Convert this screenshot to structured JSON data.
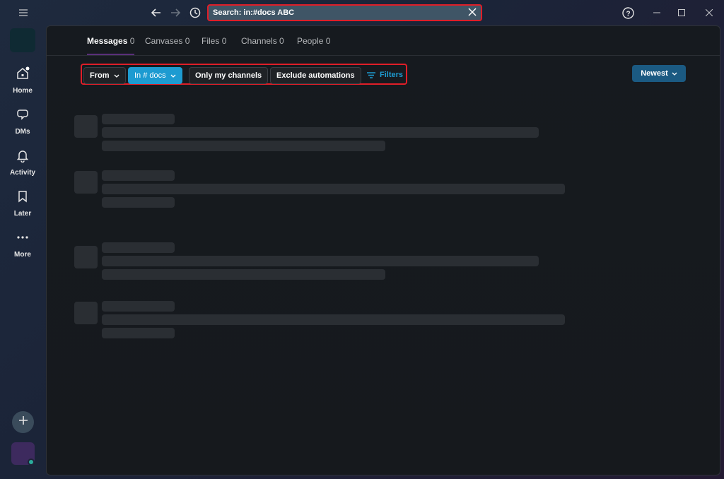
{
  "titlebar": {
    "search_text": "Search: in:#docs ABC",
    "icons": [
      "menu-icon",
      "back-arrow-icon",
      "forward-arrow-icon",
      "history-icon",
      "close-icon",
      "help-icon",
      "minimize-icon",
      "maximize-icon",
      "window-close-icon"
    ]
  },
  "rail": {
    "items": [
      {
        "label": "Home",
        "icon": "home-icon"
      },
      {
        "label": "DMs",
        "icon": "dms-icon"
      },
      {
        "label": "Activity",
        "icon": "bell-icon"
      },
      {
        "label": "Later",
        "icon": "bookmark-icon"
      },
      {
        "label": "More",
        "icon": "more-icon"
      }
    ]
  },
  "tabs": [
    {
      "label": "Messages",
      "count": "0"
    },
    {
      "label": "Canvases",
      "count": "0"
    },
    {
      "label": "Files",
      "count": "0"
    },
    {
      "label": "Channels",
      "count": "0"
    },
    {
      "label": "People",
      "count": "0"
    }
  ],
  "filters": {
    "from": "From",
    "in_channel": "In # docs",
    "only_my_channels": "Only my channels",
    "exclude_automations": "Exclude automations",
    "filters_link": "Filters"
  },
  "sort": {
    "label": "Newest"
  },
  "colors": {
    "accent": "#1d9bd1",
    "highlight_border": "#e01e28",
    "sort_button": "#1b5a82"
  }
}
